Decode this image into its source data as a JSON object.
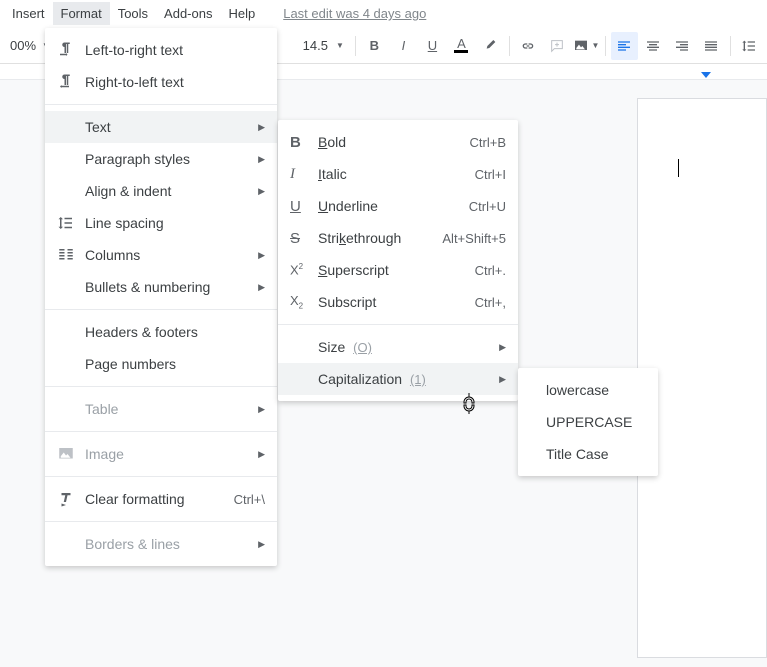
{
  "menubar": {
    "items": [
      "Insert",
      "Format",
      "Tools",
      "Add-ons",
      "Help"
    ],
    "active": "Format",
    "last_edit": "Last edit was 4 days ago"
  },
  "toolbar": {
    "zoom": "00%",
    "font_size": "14.5"
  },
  "format_menu": {
    "ltr": "Left-to-right text",
    "rtl": "Right-to-left text",
    "text": "Text",
    "paragraph_styles": "Paragraph styles",
    "align_indent": "Align & indent",
    "line_spacing": "Line spacing",
    "columns": "Columns",
    "bullets_numbering": "Bullets & numbering",
    "headers_footers": "Headers & footers",
    "page_numbers": "Page numbers",
    "table": "Table",
    "image": "Image",
    "clear_formatting": "Clear formatting",
    "clear_formatting_shortcut": "Ctrl+\\",
    "borders_lines": "Borders & lines"
  },
  "text_submenu": {
    "bold": "old",
    "bold_prefix": "B",
    "bold_shortcut": "Ctrl+B",
    "italic": "talic",
    "italic_prefix": "I",
    "italic_shortcut": "Ctrl+I",
    "underline": "nderline",
    "underline_prefix": "U",
    "underline_shortcut": "Ctrl+U",
    "strike_pre": "Stri",
    "strike_k": "k",
    "strike_post": "ethrough",
    "strike_shortcut": "Alt+Shift+5",
    "superscript": "uperscript",
    "superscript_prefix": "S",
    "superscript_shortcut": "Ctrl+.",
    "subscript": "Subscript",
    "subscript_shortcut": "Ctrl+,",
    "size": "Size",
    "size_hint": "(O)",
    "capitalization": "Capitalization",
    "cap_hint": "(1)"
  },
  "cap_submenu": {
    "lowercase": "lowercase",
    "uppercase": "UPPERCASE",
    "titlecase": "Title Case"
  }
}
